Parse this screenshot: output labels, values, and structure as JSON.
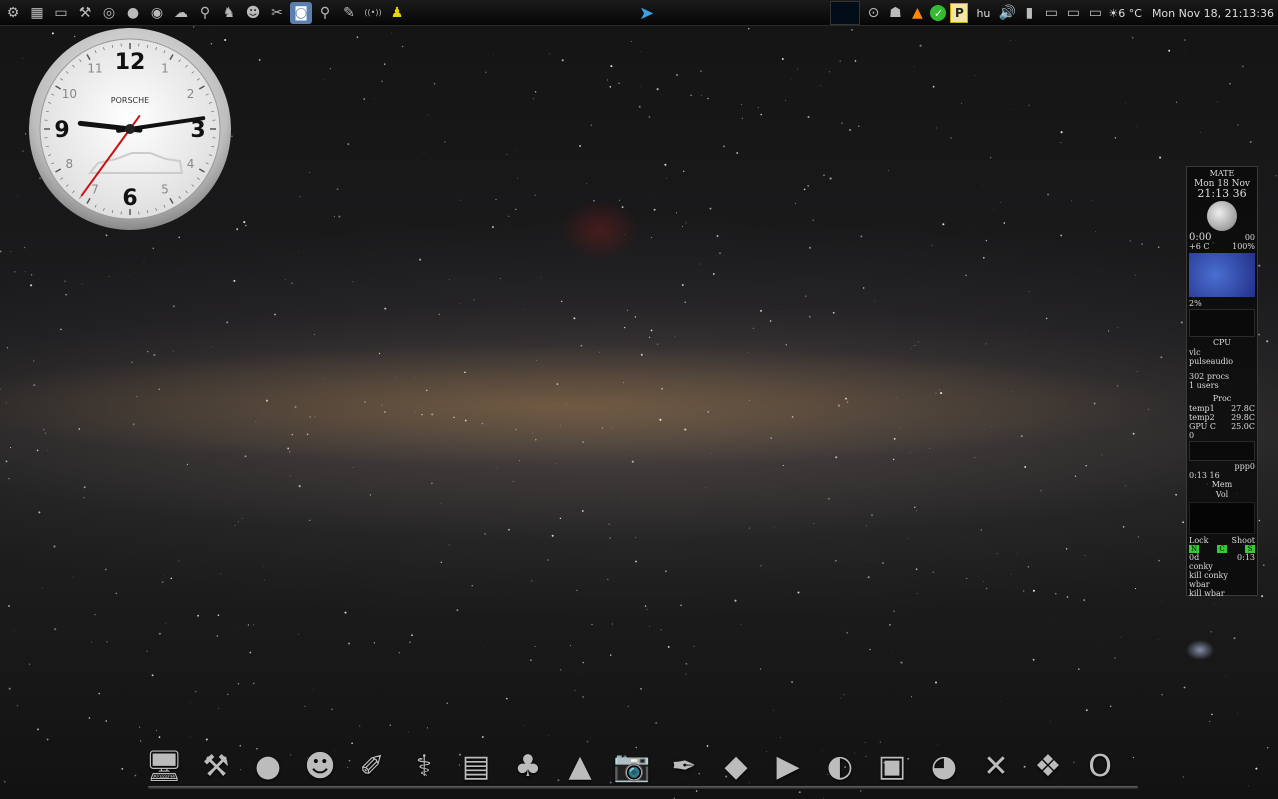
{
  "top_panel": {
    "launchers": [
      {
        "name": "menu-gear-icon",
        "glyph": "⚙"
      },
      {
        "name": "files-icon",
        "glyph": "▦"
      },
      {
        "name": "terminal-icon",
        "glyph": "▭"
      },
      {
        "name": "tools-icon",
        "glyph": "⚒"
      },
      {
        "name": "spiral-icon",
        "glyph": "◎"
      },
      {
        "name": "orb-icon",
        "glyph": "●"
      },
      {
        "name": "color-wheel-icon",
        "glyph": "◉"
      },
      {
        "name": "network-icon",
        "glyph": "☁"
      },
      {
        "name": "satellite-icon",
        "glyph": "⚲"
      },
      {
        "name": "bug-icon",
        "glyph": "♞"
      },
      {
        "name": "gimp-icon",
        "glyph": "☻"
      },
      {
        "name": "scissors-icon",
        "glyph": "✂"
      },
      {
        "name": "webcam-icon",
        "glyph": "◙",
        "active": true
      },
      {
        "name": "scanner-icon",
        "glyph": "⚲"
      },
      {
        "name": "pen-icon",
        "glyph": "✎"
      },
      {
        "name": "wireless-icon",
        "glyph": "((•))"
      },
      {
        "name": "aim-icon",
        "glyph": "♟"
      }
    ],
    "tray": {
      "keyboard_layout": "hu",
      "p_badge": "P",
      "weather": "☀6 °C",
      "datetime": "Mon Nov 18, 21:13:36"
    }
  },
  "clock": {
    "brand": "PORSCHE",
    "numerals": [
      "12",
      "1",
      "2",
      "3",
      "4",
      "5",
      "6",
      "7",
      "8",
      "9",
      "10",
      "11"
    ],
    "time": {
      "h": 21,
      "m": 13,
      "s": 36
    }
  },
  "conky": {
    "title": "MATE",
    "date_line": "Mon 18 Nov",
    "time_line": "21:13 36",
    "uptime": "0:00",
    "uptime_sec": "00",
    "temp_out": "+6 C",
    "humidity": "100%",
    "cpu_pct": "2%",
    "cpu_label": "CPU",
    "top_procs": [
      "vlc",
      "pulseaudio"
    ],
    "procs": "302 procs",
    "users": "1 users",
    "proc_label": "Proc",
    "temps": [
      {
        "label": "temp1",
        "value": "27.8C"
      },
      {
        "label": "temp2",
        "value": "29.8C"
      },
      {
        "label": "GPU C",
        "value": "25.0C"
      }
    ],
    "net_zero": "0",
    "net_iface": "ppp0",
    "net_time": "0:13 16",
    "mem_label": "Mem",
    "vol_label": "Vol",
    "lock_label": "Lock",
    "shoot_label": "Shoot",
    "leds": [
      "N",
      "C",
      "S"
    ],
    "days": "0d",
    "days_time": "0:13",
    "commands": [
      "conky",
      "kill conky",
      "wbar",
      "kill wbar"
    ]
  },
  "dock": [
    {
      "name": "monitor-icon",
      "glyph": "🖥"
    },
    {
      "name": "hammer-icon",
      "glyph": "⚒"
    },
    {
      "name": "black-orb-icon",
      "glyph": "●"
    },
    {
      "name": "gimp-wilber-icon",
      "glyph": "☻"
    },
    {
      "name": "ruler-pencil-icon",
      "glyph": "✐"
    },
    {
      "name": "stethoscope-icon",
      "glyph": "⚕"
    },
    {
      "name": "filing-cabinet-icon",
      "glyph": "▤"
    },
    {
      "name": "club-icon",
      "glyph": "♣"
    },
    {
      "name": "vlc-cone-icon",
      "glyph": "▲"
    },
    {
      "name": "camera-icon",
      "glyph": "📷"
    },
    {
      "name": "fountain-pen-icon",
      "glyph": "✒"
    },
    {
      "name": "tray-icon",
      "glyph": "◆"
    },
    {
      "name": "play-icon",
      "glyph": "▶"
    },
    {
      "name": "mask-icon",
      "glyph": "◐"
    },
    {
      "name": "radio-icon",
      "glyph": "▣"
    },
    {
      "name": "speaker-icon",
      "glyph": "◕"
    },
    {
      "name": "screwdriver-icon",
      "glyph": "✕"
    },
    {
      "name": "package-icon",
      "glyph": "❖"
    },
    {
      "name": "opera-icon",
      "glyph": "O"
    }
  ]
}
